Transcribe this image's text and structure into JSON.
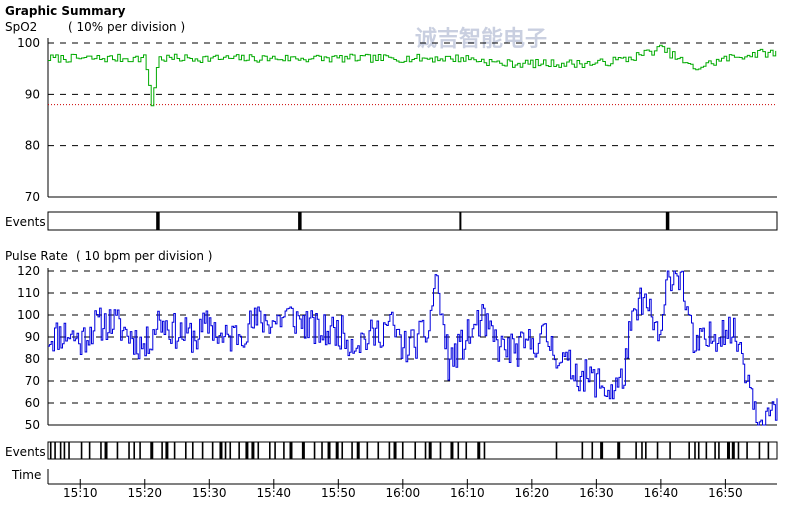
{
  "title": "Graphic Summary",
  "watermark": "诚吉智能电子",
  "spo2": {
    "label": "SpO2",
    "division": "( 10% per division )",
    "color": "#00aa00",
    "threshold_color": "#cc0000",
    "threshold": 88,
    "ylim": [
      70,
      100
    ],
    "ticks": [
      70,
      80,
      90,
      100
    ]
  },
  "pulse": {
    "label": "Pulse Rate",
    "division": "( 10 bpm per division )",
    "color": "#0000dd",
    "ylim": [
      50,
      120
    ],
    "ticks": [
      50,
      60,
      70,
      80,
      90,
      100,
      110,
      120
    ]
  },
  "events_label": "Events",
  "time_label": "Time",
  "time_ticks": [
    "15:10",
    "15:20",
    "15:30",
    "15:40",
    "15:50",
    "16:00",
    "16:10",
    "16:20",
    "16:30",
    "16:40",
    "16:50"
  ],
  "chart_data": [
    {
      "type": "line",
      "title": "SpO2",
      "ylabel": "( 10% per division )",
      "ylim": [
        70,
        100
      ],
      "x": [
        "15:05",
        "15:10",
        "15:15",
        "15:20",
        "15:21",
        "15:22",
        "15:25",
        "15:30",
        "15:35",
        "15:40",
        "15:45",
        "15:50",
        "15:55",
        "16:00",
        "16:05",
        "16:10",
        "16:15",
        "16:20",
        "16:25",
        "16:30",
        "16:35",
        "16:40",
        "16:45",
        "16:50",
        "16:55"
      ],
      "series": [
        {
          "values": [
            97,
            97,
            97,
            97,
            88,
            97,
            97,
            97,
            97,
            97,
            97,
            97,
            97,
            97,
            97,
            97,
            96,
            96,
            96,
            96,
            97,
            99,
            95,
            97,
            98
          ]
        }
      ],
      "reference_line": 88
    },
    {
      "type": "line",
      "title": "Pulse Rate",
      "ylabel": "( 10 bpm per division )",
      "ylim": [
        50,
        120
      ],
      "x": [
        "15:05",
        "15:08",
        "15:10",
        "15:12",
        "15:15",
        "15:18",
        "15:20",
        "15:22",
        "15:25",
        "15:28",
        "15:30",
        "15:32",
        "15:35",
        "15:38",
        "15:40",
        "15:42",
        "15:45",
        "15:47",
        "15:50",
        "15:52",
        "15:55",
        "15:58",
        "16:00",
        "16:02",
        "16:04",
        "16:05",
        "16:07",
        "16:10",
        "16:12",
        "16:15",
        "16:18",
        "16:20",
        "16:22",
        "16:25",
        "16:28",
        "16:30",
        "16:32",
        "16:34",
        "16:35",
        "16:37",
        "16:40",
        "16:41",
        "16:43",
        "16:45",
        "16:47",
        "16:50",
        "16:52",
        "16:55"
      ],
      "series": [
        {
          "values": [
            90,
            92,
            88,
            95,
            97,
            90,
            85,
            98,
            92,
            90,
            97,
            88,
            93,
            98,
            97,
            100,
            96,
            92,
            93,
            88,
            90,
            96,
            85,
            88,
            93,
            119,
            78,
            90,
            98,
            85,
            84,
            88,
            90,
            78,
            72,
            70,
            65,
            70,
            90,
            108,
            88,
            119,
            119,
            85,
            88,
            95,
            88,
            55
          ]
        }
      ]
    }
  ]
}
